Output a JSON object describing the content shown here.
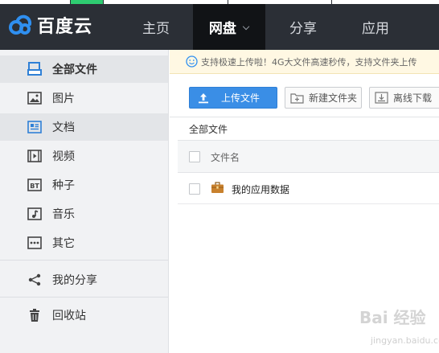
{
  "colors": {
    "topbar_bg": "#2b2f36",
    "nav_active_bg": "#111316",
    "upload_btn_bg": "#3a8ee6",
    "notice_bg": "#fff8e3",
    "sidebar_bg": "#f1f2f4",
    "top_strips": [
      "#ffffff",
      "#2ecc71",
      "#ffffff",
      "#ffffff",
      "#ffffff"
    ]
  },
  "app": {
    "logo_text": "百度云",
    "logo_icon": "baidu-cloud-logo"
  },
  "nav": {
    "home": "主页",
    "netdisk": "网盘",
    "share": "分享",
    "apps": "应用"
  },
  "sidebar": {
    "items": [
      {
        "label": "全部文件",
        "icon": "all-files-icon"
      },
      {
        "label": "图片",
        "icon": "image-icon"
      },
      {
        "label": "文档",
        "icon": "document-icon"
      },
      {
        "label": "视频",
        "icon": "video-icon"
      },
      {
        "label": "种子",
        "icon": "torrent-icon"
      },
      {
        "label": "音乐",
        "icon": "music-icon"
      },
      {
        "label": "其它",
        "icon": "other-icon"
      },
      {
        "label": "我的分享",
        "icon": "share-icon"
      },
      {
        "label": "回收站",
        "icon": "trash-icon"
      }
    ]
  },
  "notice": {
    "text": "支持极速上传啦！4G大文件高速秒传，支持文件夹上传"
  },
  "toolbar": {
    "upload": "上传文件",
    "new_folder": "新建文件夹",
    "offline_download": "离线下载"
  },
  "breadcrumb": "全部文件",
  "table": {
    "header_name": "文件名",
    "rows": [
      {
        "name": "我的应用数据",
        "icon": "app-data-folder-icon"
      }
    ]
  },
  "watermark": {
    "main": "Bai 经验",
    "sub": "jingyan.baidu.com"
  }
}
